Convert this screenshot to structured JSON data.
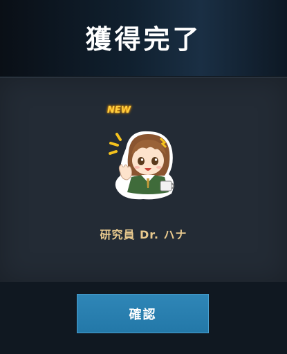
{
  "header": {
    "title": "獲得完了"
  },
  "reward": {
    "new_badge": "NEW",
    "item_name": "研究員 Dr. ハナ",
    "icon": "chibi-character-sticker"
  },
  "actions": {
    "confirm_label": "確認"
  },
  "colors": {
    "accent_button": "#2378a8",
    "item_name": "#e8c98e",
    "new_badge": "#ffcf40"
  }
}
